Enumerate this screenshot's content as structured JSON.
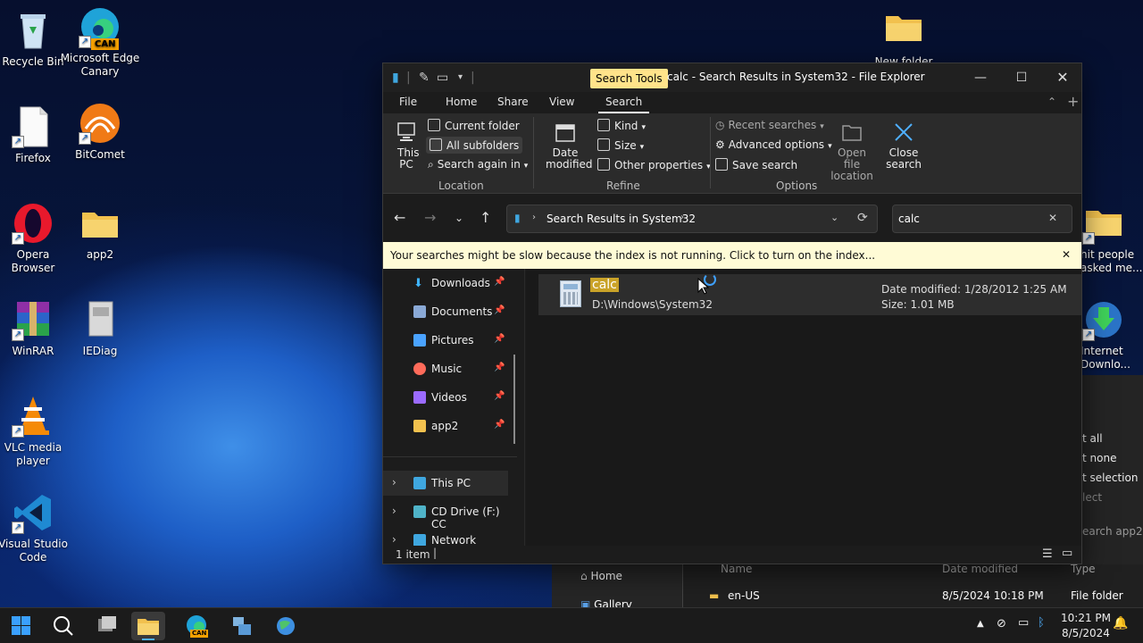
{
  "desktop": {
    "icons": [
      {
        "label": "Recycle Bin"
      },
      {
        "label": "Microsoft Edge Canary",
        "badge": "CAN"
      },
      {
        "label": "Firefox"
      },
      {
        "label": "BitComet"
      },
      {
        "label": "Opera Browser"
      },
      {
        "label": "app2"
      },
      {
        "label": "WinRAR"
      },
      {
        "label": "IEDiag"
      },
      {
        "label": "VLC media player"
      },
      {
        "label": "Visual Studio Code"
      },
      {
        "label": "New folder"
      },
      {
        "label": "hit people asked me..."
      },
      {
        "label": "Internet Downlo..."
      }
    ]
  },
  "explorer": {
    "title": "calc - Search Results in System32 - File Explorer",
    "contextual_tab": "Search Tools",
    "tabs": [
      "File",
      "Home",
      "Share",
      "View",
      "Search"
    ],
    "ribbon": {
      "this_pc": "This PC",
      "current_folder": "Current folder",
      "all_subfolders": "All subfolders",
      "search_again_in": "Search again in",
      "location_group": "Location",
      "date_modified": "Date modified",
      "kind": "Kind",
      "size": "Size",
      "other_properties": "Other properties",
      "refine_group": "Refine",
      "recent_searches": "Recent searches",
      "advanced_options": "Advanced options",
      "save_search": "Save search",
      "open_file_location": "Open file location",
      "close_search": "Close search",
      "options_group": "Options"
    },
    "address": "Search Results in System32",
    "search_value": "calc",
    "info_bar": "Your searches might be slow because the index is not running.  Click to turn on the index...",
    "nav": {
      "quick": [
        {
          "label": "Downloads",
          "color": "#3fb5ff"
        },
        {
          "label": "Documents",
          "color": "#8aa9d6"
        },
        {
          "label": "Pictures",
          "color": "#4aa3ff"
        },
        {
          "label": "Music",
          "color": "#ff6b5a"
        },
        {
          "label": "Videos",
          "color": "#9b6bff"
        },
        {
          "label": "app2",
          "color": "#f2c14e"
        }
      ],
      "tree": [
        {
          "label": "This PC",
          "color": "#3fa7e0"
        },
        {
          "label": "CD Drive (F:) CC",
          "color": "#4fb3c8"
        },
        {
          "label": "Network",
          "color": "#3fa7e0"
        }
      ]
    },
    "result": {
      "name": "calc",
      "path": "D:\\Windows\\System32",
      "date_modified": "Date modified: 1/28/2012 1:25 AM",
      "size": "Size: 1.01 MB"
    },
    "status": "1 item"
  },
  "background_window": {
    "nav_home": "Home",
    "nav_gallery": "Gallery",
    "col_name": "Name",
    "col_date": "Date modified",
    "col_type": "Type",
    "row_name": "en-US",
    "row_date": "8/5/2024 10:18 PM",
    "row_type": "File folder",
    "menu": [
      "t all",
      "t none",
      "t selection",
      "lect"
    ],
    "search": "earch app2"
  },
  "taskbar": {
    "time": "10:21 PM",
    "date": "8/5/2024",
    "edge_badge": "CAN"
  },
  "colors": {
    "accent_highlight": "#ffe38a",
    "info_bar": "#fffbd6",
    "ribbon_bg": "#2b2b2b"
  }
}
